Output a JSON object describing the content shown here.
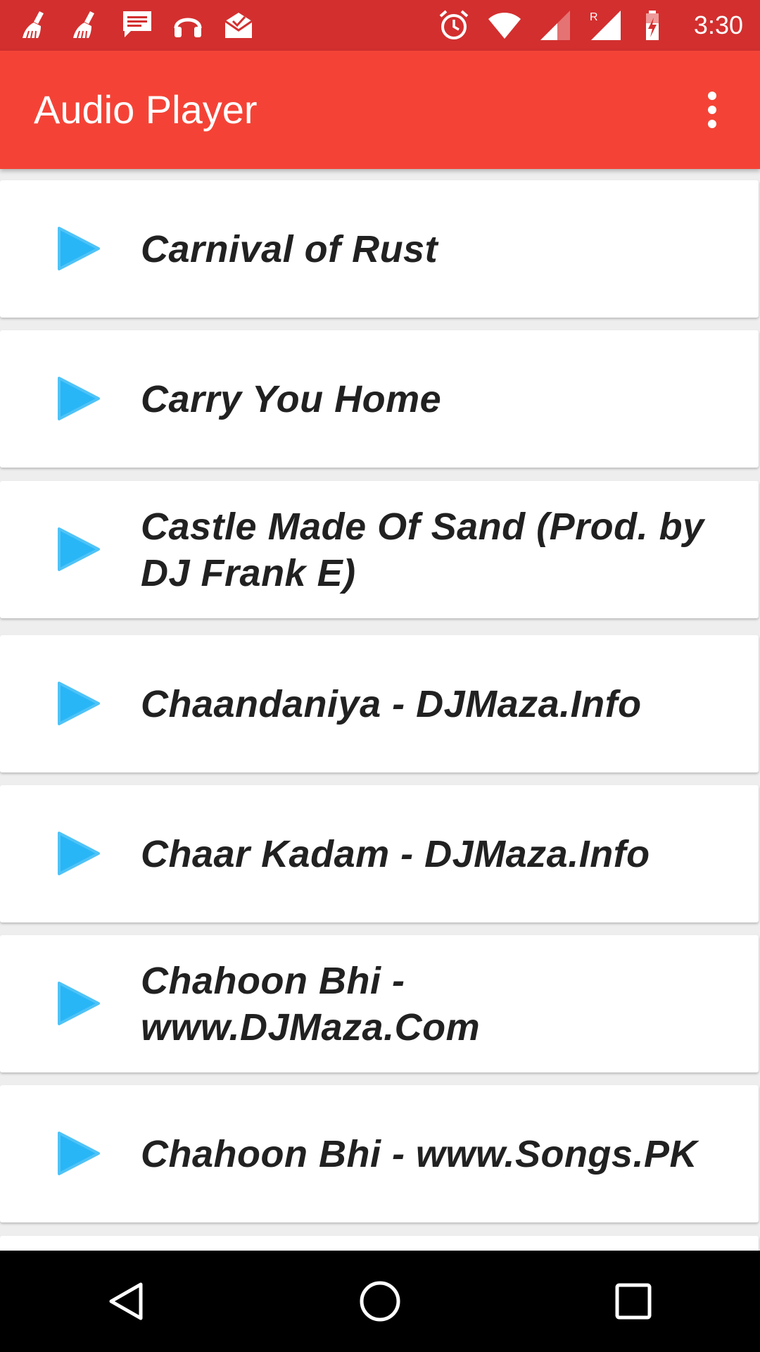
{
  "status_bar": {
    "time": "3:30",
    "left_icons": [
      "cleaner-icon",
      "cleaner-icon",
      "message-icon",
      "headphones-icon",
      "mail-icon"
    ],
    "right_icons": [
      "alarm-icon",
      "wifi-icon",
      "signal-icon",
      "roaming-signal-icon",
      "battery-charging-icon"
    ],
    "color": "#d32f2f"
  },
  "app_bar": {
    "title": "Audio Player",
    "menu_icon": "more-vert-icon",
    "color": "#f44336"
  },
  "songs": [
    {
      "title": "Carnival of Rust"
    },
    {
      "title": "Carry You Home"
    },
    {
      "title": "Castle Made Of Sand (Prod. by DJ Frank E)"
    },
    {
      "title": "Chaandaniya - DJMaza.Info"
    },
    {
      "title": "Chaar Kadam - DJMaza.Info"
    },
    {
      "title": "Chahoon Bhi - www.DJMaza.Com"
    },
    {
      "title": "Chahoon Bhi - www.Songs.PK"
    }
  ],
  "play_icon_color": "#29b6f6",
  "nav_bar": {
    "buttons": [
      "back-icon",
      "home-icon",
      "recents-icon"
    ]
  }
}
